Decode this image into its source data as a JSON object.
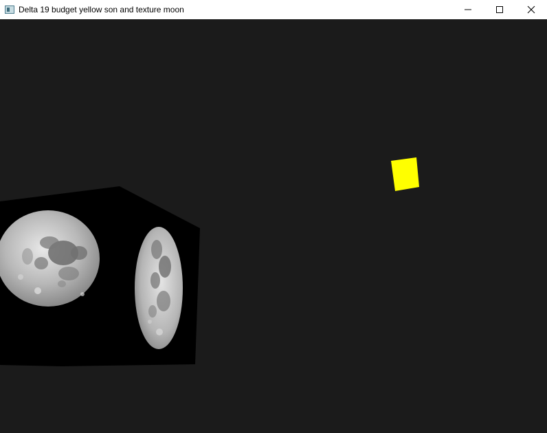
{
  "window": {
    "title": "Delta 19 budget yellow son and texture moon",
    "app_icon": "app-window-icon",
    "controls": {
      "minimize_icon": "minimize-icon",
      "maximize_icon": "maximize-icon",
      "close_icon": "close-icon"
    }
  },
  "scene": {
    "background_color": "#1b1b1b",
    "sun_color": "#ffff00",
    "cube_color": "#000000",
    "moon_texture": "moon-texture"
  }
}
